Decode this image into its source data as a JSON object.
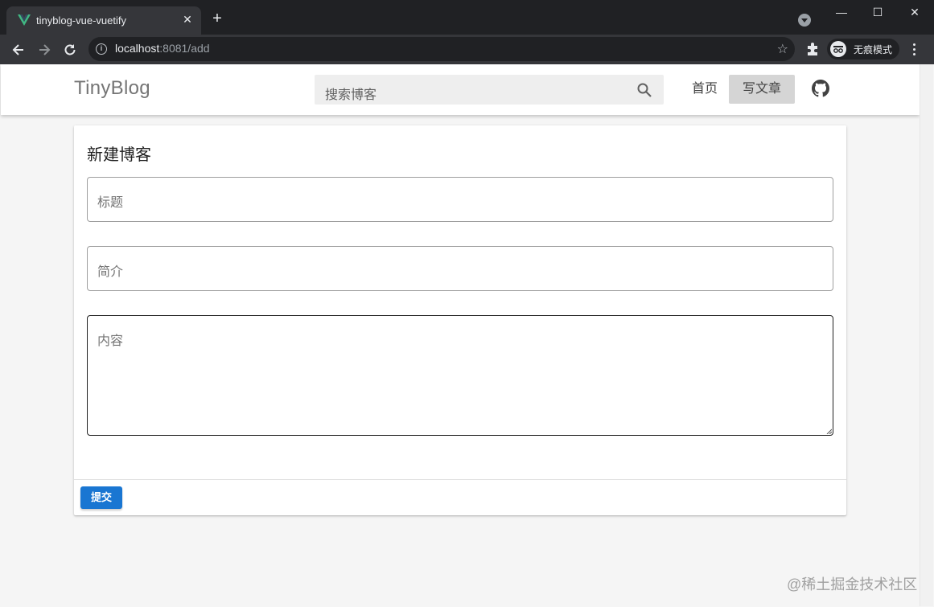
{
  "browser": {
    "tab_title": "tinyblog-vue-vuetify",
    "url_host": "localhost",
    "url_rest": ":8081/add",
    "incognito_label": "无痕模式",
    "icons": [
      "back-icon",
      "forward-icon",
      "reload-icon",
      "info-icon",
      "star-icon",
      "extensions-icon",
      "incognito-icon",
      "menu-icon"
    ]
  },
  "header": {
    "brand_light": "Tiny",
    "brand_bold": "Blog",
    "search_placeholder": "搜索博客",
    "nav": {
      "home": "首页",
      "write": "写文章"
    }
  },
  "form": {
    "title": "新建博客",
    "fields": {
      "title_label": "标题",
      "intro_label": "简介",
      "content_label": "内容"
    },
    "submit_label": "提交"
  },
  "watermark": "@稀土掘金技术社区",
  "colors": {
    "primary": "#1976d2",
    "chrome_dark": "#202124",
    "chrome_toolbar": "#35363a",
    "page_bg": "#f5f5f5"
  }
}
